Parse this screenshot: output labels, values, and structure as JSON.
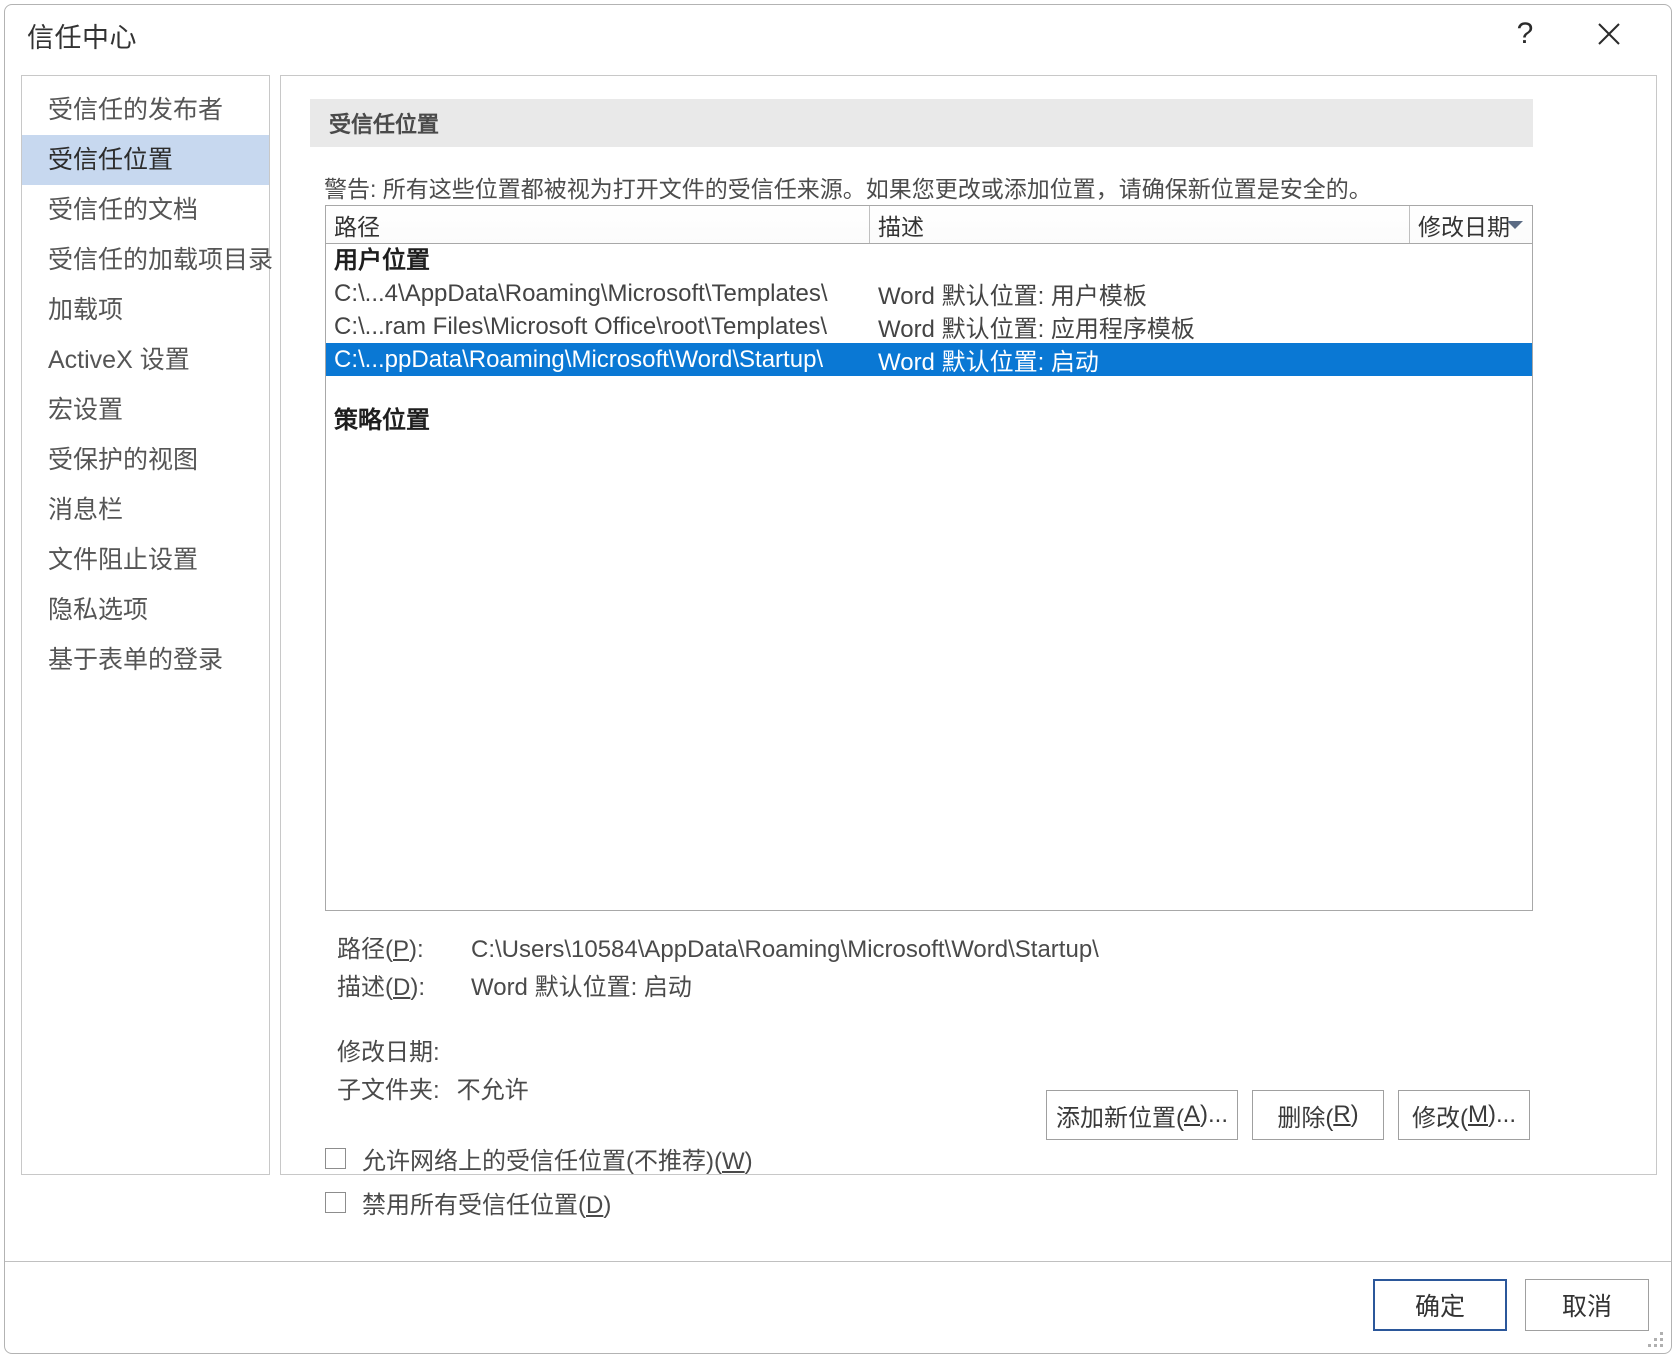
{
  "window": {
    "title": "信任中心",
    "help_icon": "question-mark-icon",
    "close_icon": "close-icon"
  },
  "sidebar": {
    "items": [
      {
        "label": "受信任的发布者",
        "selected": false
      },
      {
        "label": "受信任位置",
        "selected": true
      },
      {
        "label": "受信任的文档",
        "selected": false
      },
      {
        "label": "受信任的加载项目录",
        "selected": false
      },
      {
        "label": "加载项",
        "selected": false
      },
      {
        "label": "ActiveX 设置",
        "selected": false
      },
      {
        "label": "宏设置",
        "selected": false
      },
      {
        "label": "受保护的视图",
        "selected": false
      },
      {
        "label": "消息栏",
        "selected": false
      },
      {
        "label": "文件阻止设置",
        "selected": false
      },
      {
        "label": "隐私选项",
        "selected": false
      },
      {
        "label": "基于表单的登录",
        "selected": false
      }
    ]
  },
  "main": {
    "section_title": "受信任位置",
    "warning": "警告: 所有这些位置都被视为打开文件的受信任来源。如果您更改或添加位置，请确保新位置是安全的。",
    "list": {
      "columns": [
        {
          "label": "路径"
        },
        {
          "label": "描述"
        },
        {
          "label": "修改日期",
          "sort_icon": "chevron-down-icon"
        }
      ],
      "groups": [
        {
          "title": "用户位置",
          "rows": [
            {
              "path": "C:\\...4\\AppData\\Roaming\\Microsoft\\Templates\\",
              "description": "Word 默认位置: 用户模板",
              "date": "",
              "selected": false
            },
            {
              "path": "C:\\...ram Files\\Microsoft Office\\root\\Templates\\",
              "description": "Word 默认位置: 应用程序模板",
              "date": "",
              "selected": false
            },
            {
              "path": "C:\\...ppData\\Roaming\\Microsoft\\Word\\Startup\\",
              "description": "Word 默认位置: 启动",
              "date": "",
              "selected": true
            }
          ]
        },
        {
          "title": "策略位置",
          "rows": []
        }
      ]
    },
    "details": {
      "path_label_pre": "路径(",
      "path_label_key": "P",
      "path_label_post": "):",
      "path_value": "C:\\Users\\10584\\AppData\\Roaming\\Microsoft\\Word\\Startup\\",
      "desc_label_pre": "描述(",
      "desc_label_key": "D",
      "desc_label_post": "):",
      "desc_value": "Word 默认位置: 启动",
      "date_label": "修改日期:",
      "date_value": "",
      "subfolder_label": "子文件夹:",
      "subfolder_value": "不允许"
    },
    "action_buttons": [
      {
        "pre": "添加新位置(",
        "key": "A",
        "post": ")..."
      },
      {
        "pre": "删除(",
        "key": "R",
        "post": ")"
      },
      {
        "pre": "修改(",
        "key": "M",
        "post": ")..."
      }
    ],
    "checkboxes": [
      {
        "pre": "允许网络上的受信任位置(不推荐)(",
        "key": "W",
        "post": ")",
        "checked": false
      },
      {
        "pre": "禁用所有受信任位置(",
        "key": "D",
        "post": ")",
        "checked": false
      }
    ]
  },
  "footer": {
    "ok_label": "确定",
    "cancel_label": "取消"
  },
  "colors": {
    "selection_blue": "#0a78d4",
    "sidebar_selected": "#c7d8ef",
    "focus_border": "#2b579a",
    "section_band": "#e9e9e9"
  }
}
